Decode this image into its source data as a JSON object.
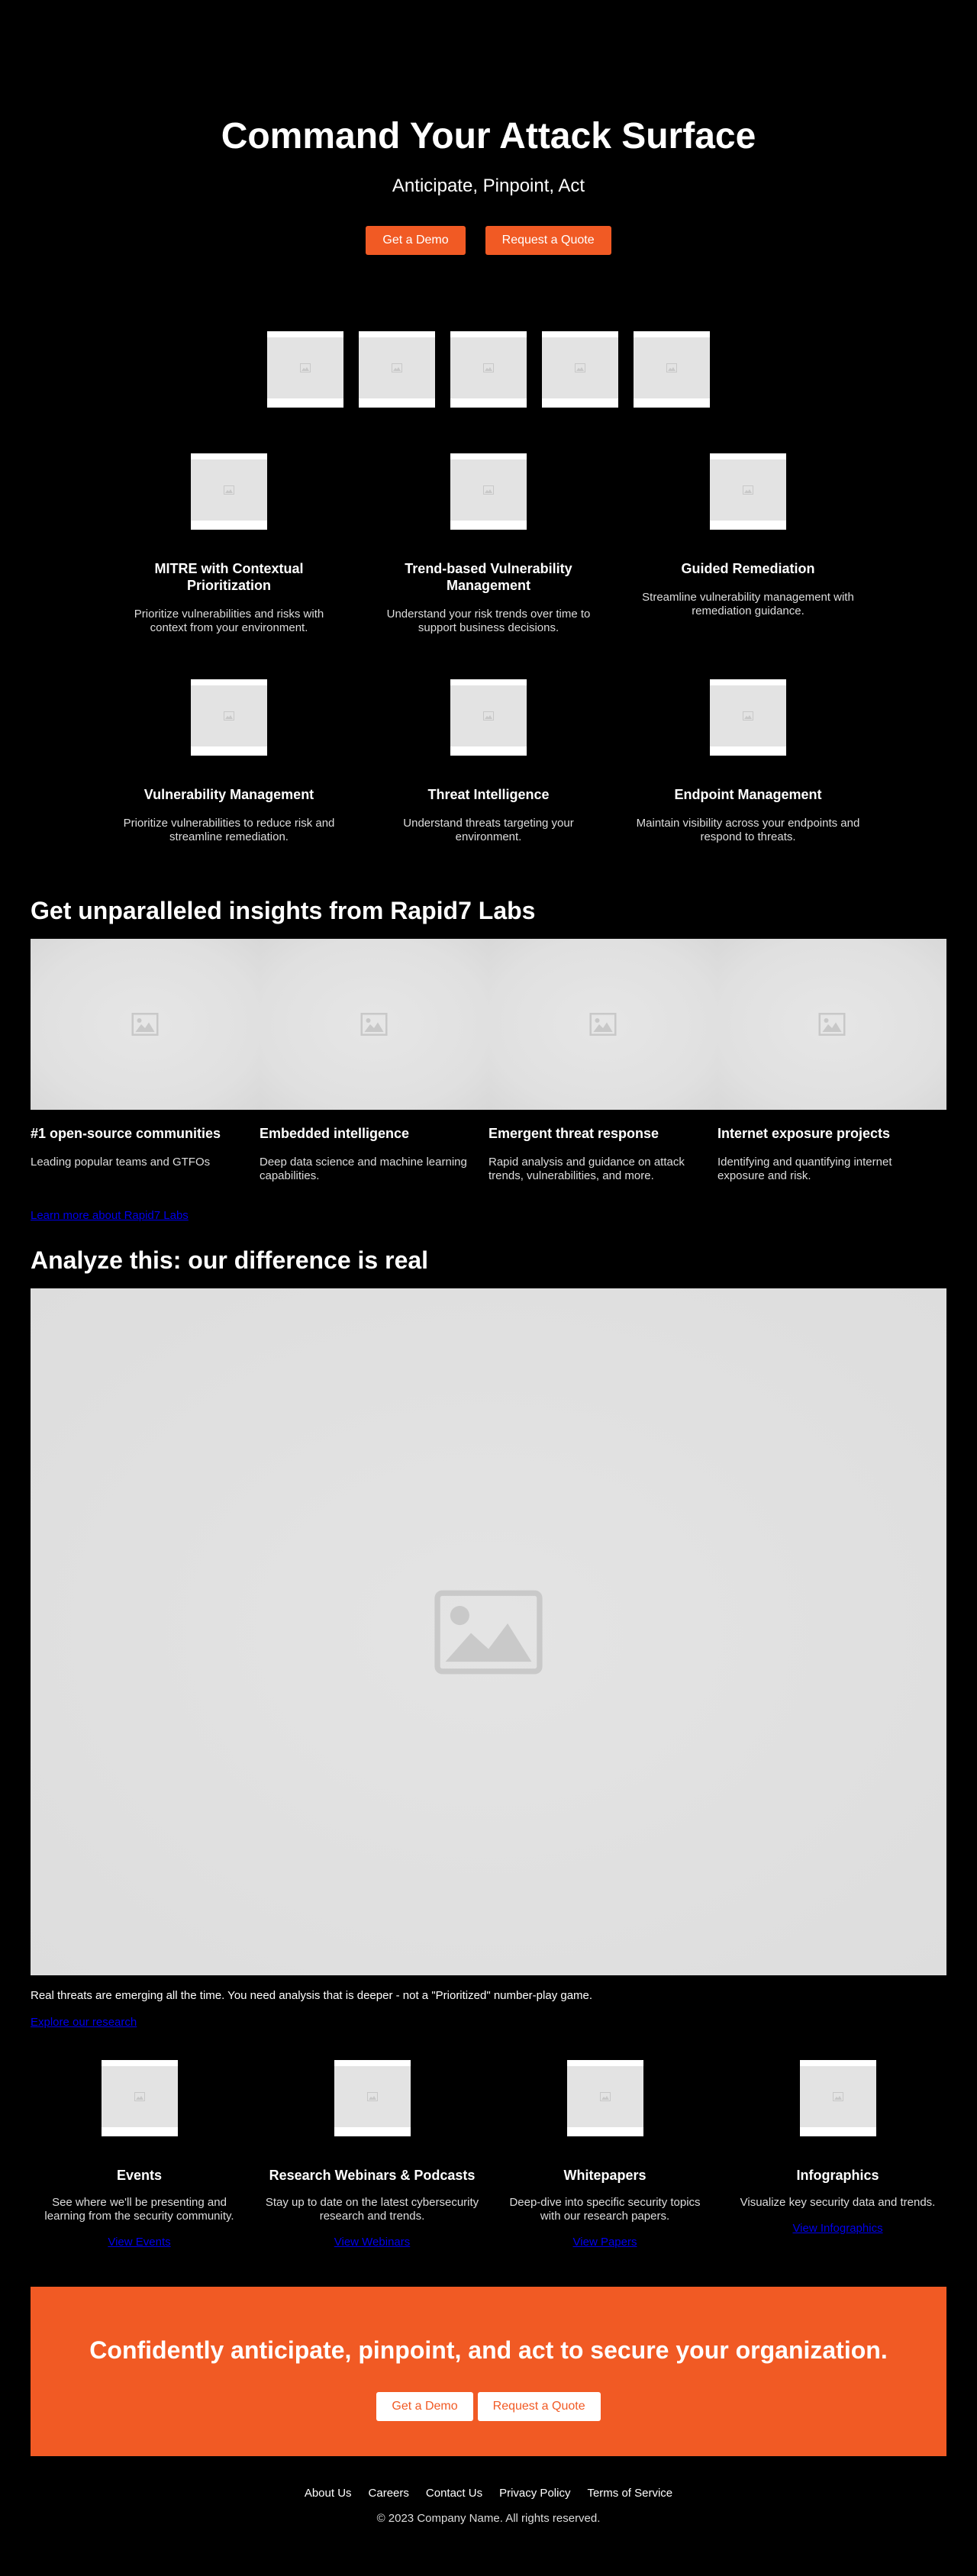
{
  "hero": {
    "title": "Command Your Attack Surface",
    "subtitle": "Anticipate, Pinpoint, Act",
    "demo_label": "Get a Demo",
    "quote_label": "Request a Quote"
  },
  "features": [
    {
      "title": "MITRE with Contextual Prioritization",
      "text": "Prioritize vulnerabilities and risks with context from your environment."
    },
    {
      "title": "Trend-based Vulnerability Management",
      "text": "Understand your risk trends over time to support business decisions."
    },
    {
      "title": "Guided Remediation",
      "text": "Streamline vulnerability management with remediation guidance."
    },
    {
      "title": "Vulnerability Management",
      "text": "Prioritize vulnerabilities to reduce risk and streamline remediation."
    },
    {
      "title": "Threat Intelligence",
      "text": "Understand threats targeting your environment."
    },
    {
      "title": "Endpoint Management",
      "text": "Maintain visibility across your endpoints and respond to threats."
    }
  ],
  "labs": {
    "heading": "Get unparalleled insights from Rapid7 Labs",
    "columns": [
      {
        "title": "#1 open-source communities",
        "text": "Leading popular teams and GTFOs"
      },
      {
        "title": "Embedded intelligence",
        "text": "Deep data science and machine learning capabilities."
      },
      {
        "title": "Emergent threat response",
        "text": "Rapid analysis and guidance on attack trends, vulnerabilities, and more."
      },
      {
        "title": "Internet exposure projects",
        "text": "Identifying and quantifying internet exposure and risk."
      }
    ],
    "link": "Learn more about Rapid7 Labs"
  },
  "analyze": {
    "heading": "Analyze this: our difference is real",
    "text": "Real threats are emerging all the time. You need analysis that is deeper - not a \"Prioritized\" number-play game.",
    "link": "Explore our research"
  },
  "resources": [
    {
      "title": "Events",
      "text": "See where we'll be presenting and learning from the security community.",
      "link": "View Events"
    },
    {
      "title": "Research Webinars & Podcasts",
      "text": "Stay up to date on the latest cybersecurity research and trends.",
      "link": "View Webinars"
    },
    {
      "title": "Whitepapers",
      "text": "Deep-dive into specific security topics with our research papers.",
      "link": "View Papers"
    },
    {
      "title": "Infographics",
      "text": "Visualize key security data and trends.",
      "link": "View Infographics"
    }
  ],
  "cta": {
    "heading": "Confidently anticipate, pinpoint, and act to secure your organization.",
    "demo_label": "Get a Demo",
    "quote_label": "Request a Quote"
  },
  "footer": {
    "links": [
      "About Us",
      "Careers",
      "Contact Us",
      "Privacy Policy",
      "Terms of Service"
    ],
    "copyright": "© 2023 Company Name. All rights reserved."
  },
  "colors": {
    "accent": "#f15a24",
    "background": "#000000",
    "placeholder": "#e3e3e3",
    "link": "#0000ee"
  }
}
